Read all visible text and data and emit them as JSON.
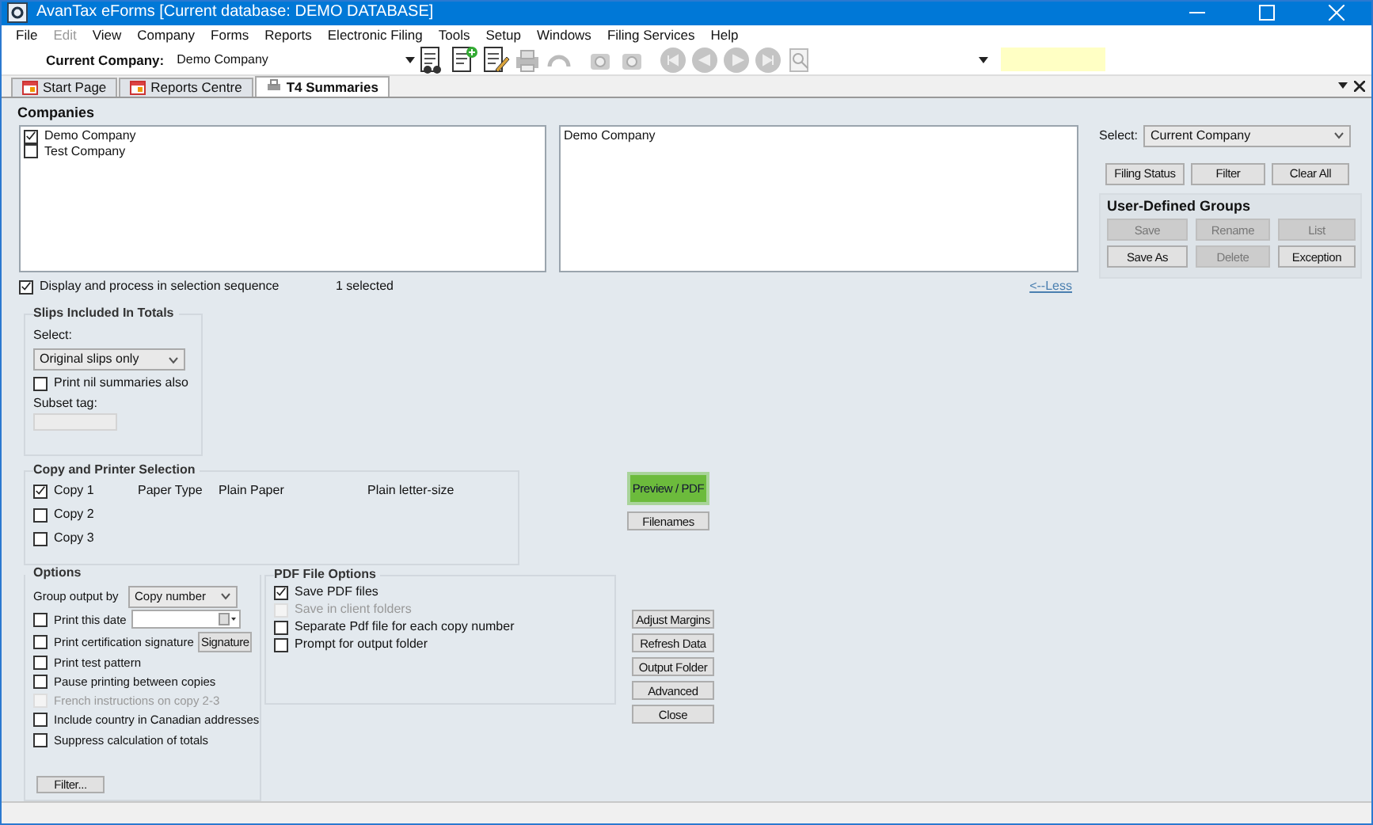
{
  "window": {
    "title": "AvanTax eForms [Current database: DEMO DATABASE]"
  },
  "menu": [
    {
      "label": "File",
      "disabled": false
    },
    {
      "label": "Edit",
      "disabled": true
    },
    {
      "label": "View",
      "disabled": false
    },
    {
      "label": "Company",
      "disabled": false
    },
    {
      "label": "Forms",
      "disabled": false
    },
    {
      "label": "Reports",
      "disabled": false
    },
    {
      "label": "Electronic Filing",
      "disabled": false
    },
    {
      "label": "Tools",
      "disabled": false
    },
    {
      "label": "Setup",
      "disabled": false
    },
    {
      "label": "Windows",
      "disabled": false
    },
    {
      "label": "Filing Services",
      "disabled": false
    },
    {
      "label": "Help",
      "disabled": false
    }
  ],
  "toolbar": {
    "company_label": "Current Company:",
    "company_value": "Demo Company"
  },
  "tabs": [
    {
      "label": "Start Page",
      "selected": false
    },
    {
      "label": "Reports Centre",
      "selected": false
    },
    {
      "label": "T4 Summaries",
      "selected": true
    }
  ],
  "companies": {
    "title": "Companies",
    "items": [
      {
        "label": "Demo Company",
        "checked": true
      },
      {
        "label": "Test Company",
        "checked": false
      }
    ],
    "selected_items": [
      "Demo Company"
    ],
    "sequence": {
      "label": "Display and process in selection sequence",
      "checked": true
    },
    "count": "1 selected",
    "less_link": "<--Less"
  },
  "selection": {
    "select_label": "Select:",
    "select_value": "Current Company",
    "buttons": [
      {
        "label": "Filing Status",
        "disabled": false
      },
      {
        "label": "Filter",
        "disabled": false
      },
      {
        "label": "Clear All",
        "disabled": false
      }
    ],
    "groups_title": "User-Defined Groups",
    "group_buttons": [
      {
        "label": "Save",
        "disabled": true
      },
      {
        "label": "Rename",
        "disabled": true
      },
      {
        "label": "List",
        "disabled": true
      },
      {
        "label": "Save As",
        "disabled": false
      },
      {
        "label": "Delete",
        "disabled": true
      },
      {
        "label": "Exception",
        "disabled": false
      }
    ]
  },
  "slips": {
    "title": "Slips Included In Totals",
    "select_label": "Select:",
    "select_value": "Original slips only",
    "nil": {
      "label": "Print nil summaries also",
      "checked": false
    },
    "subset_label": "Subset tag:"
  },
  "copies": {
    "title": "Copy and Printer Selection",
    "paper_type_label": "Paper Type",
    "rows": [
      {
        "label": "Copy 1",
        "checked": true,
        "paper": "Plain Paper",
        "size": "Plain letter-size"
      },
      {
        "label": "Copy 2",
        "checked": false
      },
      {
        "label": "Copy 3",
        "checked": false
      }
    ]
  },
  "preview_buttons": [
    {
      "label": "Preview / PDF",
      "kind": "primary"
    },
    {
      "label": "Filenames",
      "kind": "normal"
    }
  ],
  "options": {
    "title": "Options",
    "group_label": "Group output by",
    "group_value": "Copy number",
    "items": [
      {
        "kind": "date",
        "label": "Print this date",
        "checked": false,
        "disabled": false
      },
      {
        "kind": "signature",
        "label": "Print certification signature",
        "checked": false,
        "disabled": false,
        "button": "Signature"
      },
      {
        "kind": "check",
        "label": "Print test pattern",
        "checked": false,
        "disabled": false
      },
      {
        "kind": "check",
        "label": "Pause printing between copies",
        "checked": false,
        "disabled": false
      },
      {
        "kind": "check",
        "label": "French instructions on copy 2-3",
        "checked": false,
        "disabled": true
      },
      {
        "kind": "check",
        "label": "Include country in Canadian addresses",
        "checked": false,
        "disabled": false
      },
      {
        "kind": "check",
        "label": "Suppress calculation of totals",
        "checked": false,
        "disabled": false
      }
    ],
    "filter_button": "Filter..."
  },
  "pdf": {
    "title": "PDF File Options",
    "items": [
      {
        "label": "Save PDF files",
        "checked": true,
        "disabled": false
      },
      {
        "label": "Save in client folders",
        "checked": false,
        "disabled": true
      },
      {
        "label": "Separate Pdf file for each copy number",
        "checked": false,
        "disabled": false
      },
      {
        "label": "Prompt for output folder",
        "checked": false,
        "disabled": false
      }
    ]
  },
  "action_buttons": [
    "Adjust Margins",
    "Refresh Data",
    "Output Folder",
    "Advanced",
    "Close"
  ]
}
